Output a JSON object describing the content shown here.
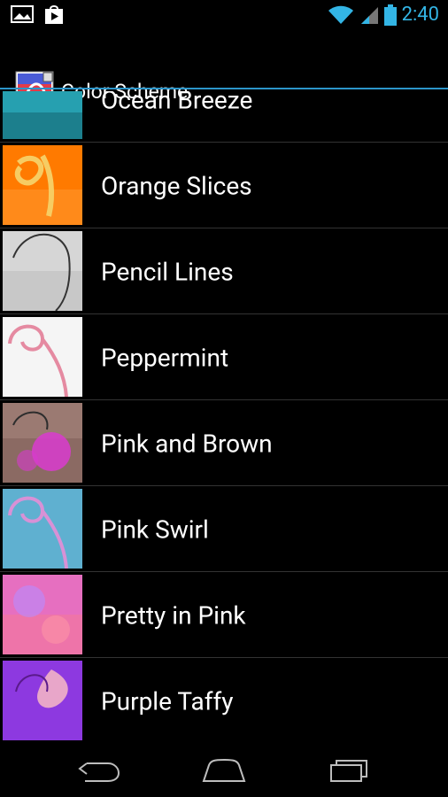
{
  "status": {
    "time": "2:40",
    "left_icons": [
      "image-icon",
      "play-store-icon"
    ],
    "right_icons": [
      "wifi-icon",
      "signal-icon",
      "battery-icon"
    ]
  },
  "app": {
    "title": "Color Scheme"
  },
  "schemes": [
    {
      "label": "Ocean Breeze",
      "colors": [
        "#2aa7b0",
        "#1f7a83"
      ]
    },
    {
      "label": "Orange Slices",
      "colors": [
        "#ff7a00",
        "#f6cc63"
      ]
    },
    {
      "label": "Pencil Lines",
      "colors": [
        "#cfcfcf",
        "#a6a6a6"
      ]
    },
    {
      "label": "Peppermint",
      "colors": [
        "#f7f7f7",
        "#e58aa1"
      ]
    },
    {
      "label": "Pink and Brown",
      "colors": [
        "#8b6a63",
        "#d93bcf"
      ]
    },
    {
      "label": "Pink Swirl",
      "colors": [
        "#5fb0d0",
        "#d891d6"
      ]
    },
    {
      "label": "Pretty in Pink",
      "colors": [
        "#ee74a9",
        "#b88cff"
      ]
    },
    {
      "label": "Purple Taffy",
      "colors": [
        "#8d39e0",
        "#f2b2c7"
      ]
    }
  ],
  "nav": {
    "icons": [
      "back-icon",
      "home-icon",
      "recent-apps-icon"
    ]
  },
  "accent": "#33b5e5"
}
